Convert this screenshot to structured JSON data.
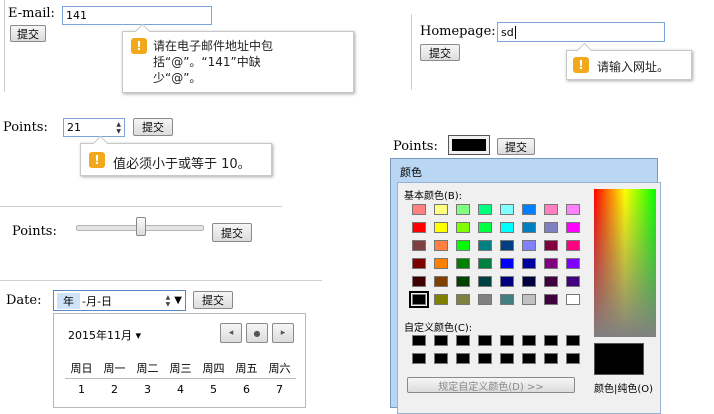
{
  "email": {
    "label": "E-mail:",
    "value": "141",
    "submit": "提交",
    "tip_lines": [
      "请在电子邮件地址中包",
      "括“@”。“141”中缺",
      "少“@”。"
    ]
  },
  "homepage": {
    "label": "Homepage:",
    "value": "sd",
    "submit": "提交",
    "tip": "请输入网址。"
  },
  "points_number": {
    "label": "Points:",
    "value": "21",
    "submit": "提交",
    "tip": "值必须小于或等于 10。",
    "spin_up": "▲",
    "spin_down": "▼"
  },
  "points_range": {
    "label": "Points:",
    "submit": "提交",
    "level": 0.5
  },
  "points_color": {
    "label": "Points:",
    "submit": "提交",
    "value_color": "#000000"
  },
  "date": {
    "label": "Date:",
    "seg_year": "年",
    "seg_rest": "-月-日",
    "submit": "提交",
    "dropdown": "▼",
    "calendar": {
      "month_label": "2015年11月",
      "month_caret": "▾",
      "nav_prev": "◂",
      "nav_today": "●",
      "nav_next": "▸",
      "weekdays": [
        "周日",
        "周一",
        "周二",
        "周三",
        "周四",
        "周五",
        "周六"
      ],
      "first_row": [
        "1",
        "2",
        "3",
        "4",
        "5",
        "6",
        "7"
      ]
    }
  },
  "color_dialog": {
    "title": "颜色",
    "basic_label": "基本颜色(B):",
    "custom_label": "自定义颜色(C):",
    "define_button": "规定自定义颜色(D) >>",
    "solid_label": "颜色|纯色(O)",
    "basic_colors": [
      [
        "#ff8080",
        "#ffff80",
        "#80ff80",
        "#00ff80",
        "#80ffff",
        "#0080ff",
        "#ff80c0",
        "#ff80ff"
      ],
      [
        "#ff0000",
        "#ffff00",
        "#80ff00",
        "#00ff40",
        "#00ffff",
        "#0080c0",
        "#8080c0",
        "#ff00ff"
      ],
      [
        "#804040",
        "#ff8040",
        "#00ff00",
        "#008080",
        "#004080",
        "#8080ff",
        "#800040",
        "#ff0080"
      ],
      [
        "#800000",
        "#ff8000",
        "#008000",
        "#008040",
        "#0000ff",
        "#0000a0",
        "#800080",
        "#8000ff"
      ],
      [
        "#400000",
        "#804000",
        "#004000",
        "#004040",
        "#000080",
        "#000040",
        "#400040",
        "#400080"
      ],
      [
        "#000000",
        "#808000",
        "#808040",
        "#808080",
        "#408080",
        "#c0c0c0",
        "#400040",
        "#ffffff"
      ]
    ],
    "custom_colors": [
      "#000000",
      "#000000",
      "#000000",
      "#000000",
      "#000000",
      "#000000",
      "#000000",
      "#000000",
      "#000000",
      "#000000",
      "#000000",
      "#000000",
      "#000000",
      "#000000",
      "#000000",
      "#000000"
    ],
    "preview_color": "#000000"
  }
}
